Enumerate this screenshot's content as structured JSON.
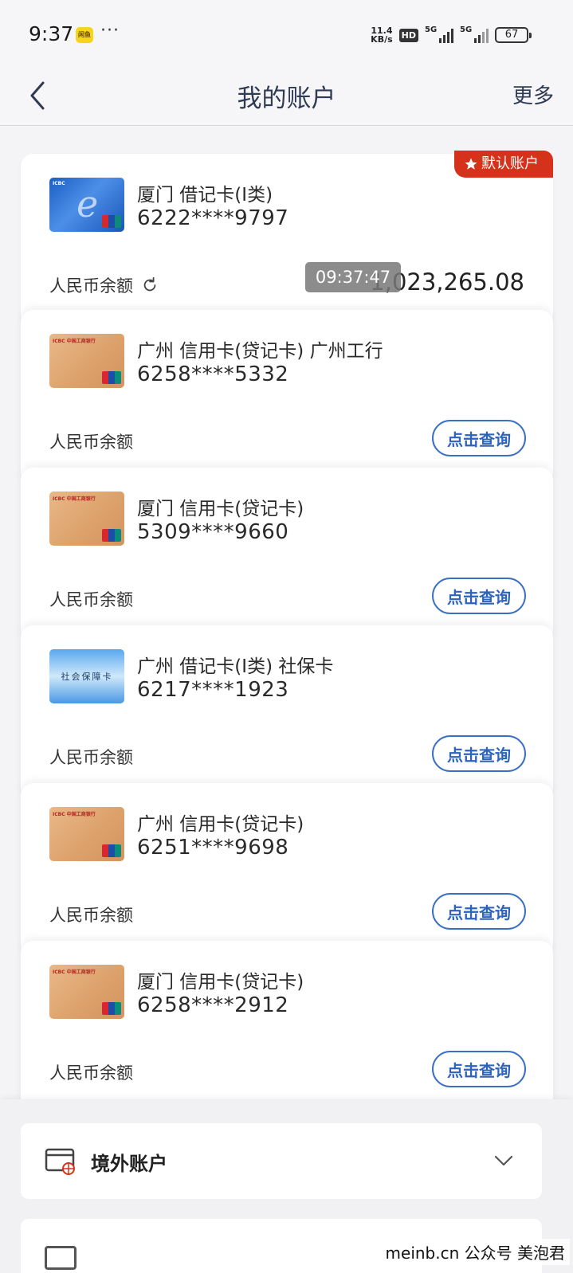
{
  "status_bar": {
    "time": "9:37",
    "app_badge": "闲鱼",
    "dots": "···",
    "speed_top": "11.4",
    "speed_bottom": "KB/s",
    "hd": "HD",
    "sig1": "5G",
    "sig2": "5G",
    "battery": "67"
  },
  "header": {
    "title": "我的账户",
    "more": "更多"
  },
  "default_tag": "默认账户",
  "toast_time": "09:37:47",
  "balance_label": "人民币余额",
  "query_label": "点击查询",
  "cards": [
    {
      "name": "厦门 借记卡(I类)",
      "number": "6222****9797",
      "balance": "1,023,265.08",
      "image": "icbc-e-debit-card"
    },
    {
      "name": "广州 信用卡(贷记卡) 广州工行",
      "number": "6258****5332",
      "image": "icbc-credit-card"
    },
    {
      "name": "厦门 信用卡(贷记卡)",
      "number": "5309****9660",
      "image": "icbc-credit-card"
    },
    {
      "name": "广州 借记卡(I类)  社保卡",
      "number": "6217****1923",
      "image": "social-security-card",
      "card_text": "社会保障卡"
    },
    {
      "name": "广州 信用卡(贷记卡)",
      "number": "6251****9698",
      "image": "icbc-credit-card"
    },
    {
      "name": "厦门 信用卡(贷记卡)",
      "number": "6258****2912",
      "image": "icbc-credit-card"
    }
  ],
  "abroad": {
    "label": "境外账户"
  },
  "watermark": "meinb.cn  公众号 美泡君",
  "colors": {
    "accent_blue": "#2d63bb",
    "default_red": "#d4321b"
  }
}
